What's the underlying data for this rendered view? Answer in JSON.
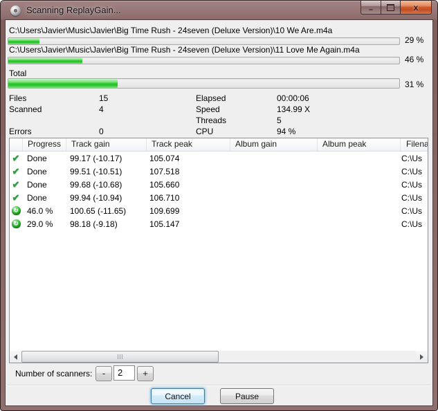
{
  "window": {
    "title": "Scanning ReplayGain...",
    "icon": "disc-icon"
  },
  "icons": {
    "minimize": "–",
    "close": "x",
    "check": "✔",
    "spinner": "↻"
  },
  "colors": {
    "titlebar_glass": "#8a6868",
    "progress_green": "#2fcb2f",
    "close_button_red": "#cf5c2f",
    "dialog_face": "#f0efef"
  },
  "progress_files": [
    {
      "path": "C:\\Users\\Javier\\Music\\Javier\\Big Time Rush - 24seven (Deluxe Version)\\10 We Are.m4a",
      "percent_label": "29 %",
      "fill_percent": 8
    },
    {
      "path": "C:\\Users\\Javier\\Music\\Javier\\Big Time Rush - 24seven (Deluxe Version)\\11 Love Me Again.m4a",
      "percent_label": "46 %",
      "fill_percent": 19
    }
  ],
  "total": {
    "label": "Total",
    "percent_label": "31 %",
    "fill_percent": 28
  },
  "stats": {
    "rows": [
      {
        "l": "Files",
        "lv": "15",
        "r": "Elapsed",
        "rv": "00:00:06"
      },
      {
        "l": "Scanned",
        "lv": "4",
        "r": "Speed",
        "rv": "134.99 X"
      },
      {
        "l": "",
        "lv": "",
        "r": "Threads",
        "rv": "5"
      },
      {
        "l": "Errors",
        "lv": "0",
        "r": "CPU",
        "rv": "94 %"
      }
    ]
  },
  "table": {
    "columns": [
      "",
      "Progress",
      "Track gain",
      "Track peak",
      "Album gain",
      "Album peak",
      "Filena"
    ],
    "rows": [
      {
        "icon": "check",
        "progress": "Done",
        "track_gain": "99.17 (-10.17)",
        "track_peak": "105.074",
        "album_gain": "",
        "album_peak": "",
        "filename": "C:\\Us"
      },
      {
        "icon": "check",
        "progress": "Done",
        "track_gain": "99.51 (-10.51)",
        "track_peak": "107.518",
        "album_gain": "",
        "album_peak": "",
        "filename": "C:\\Us"
      },
      {
        "icon": "check",
        "progress": "Done",
        "track_gain": "99.68 (-10.68)",
        "track_peak": "105.660",
        "album_gain": "",
        "album_peak": "",
        "filename": "C:\\Us"
      },
      {
        "icon": "check",
        "progress": "Done",
        "track_gain": "99.94 (-10.94)",
        "track_peak": "106.710",
        "album_gain": "",
        "album_peak": "",
        "filename": "C:\\Us"
      },
      {
        "icon": "spinner",
        "progress": "46.0 %",
        "track_gain": "100.65 (-11.65)",
        "track_peak": "109.699",
        "album_gain": "",
        "album_peak": "",
        "filename": "C:\\Us"
      },
      {
        "icon": "spinner",
        "progress": "29.0 %",
        "track_gain": "98.18 (-9.18)",
        "track_peak": "105.147",
        "album_gain": "",
        "album_peak": "",
        "filename": "C:\\Us"
      }
    ]
  },
  "scanners": {
    "label": "Number of scanners:",
    "decrease": "-",
    "value": "2",
    "increase": "+"
  },
  "footer": {
    "cancel": "Cancel",
    "pause": "Pause"
  }
}
